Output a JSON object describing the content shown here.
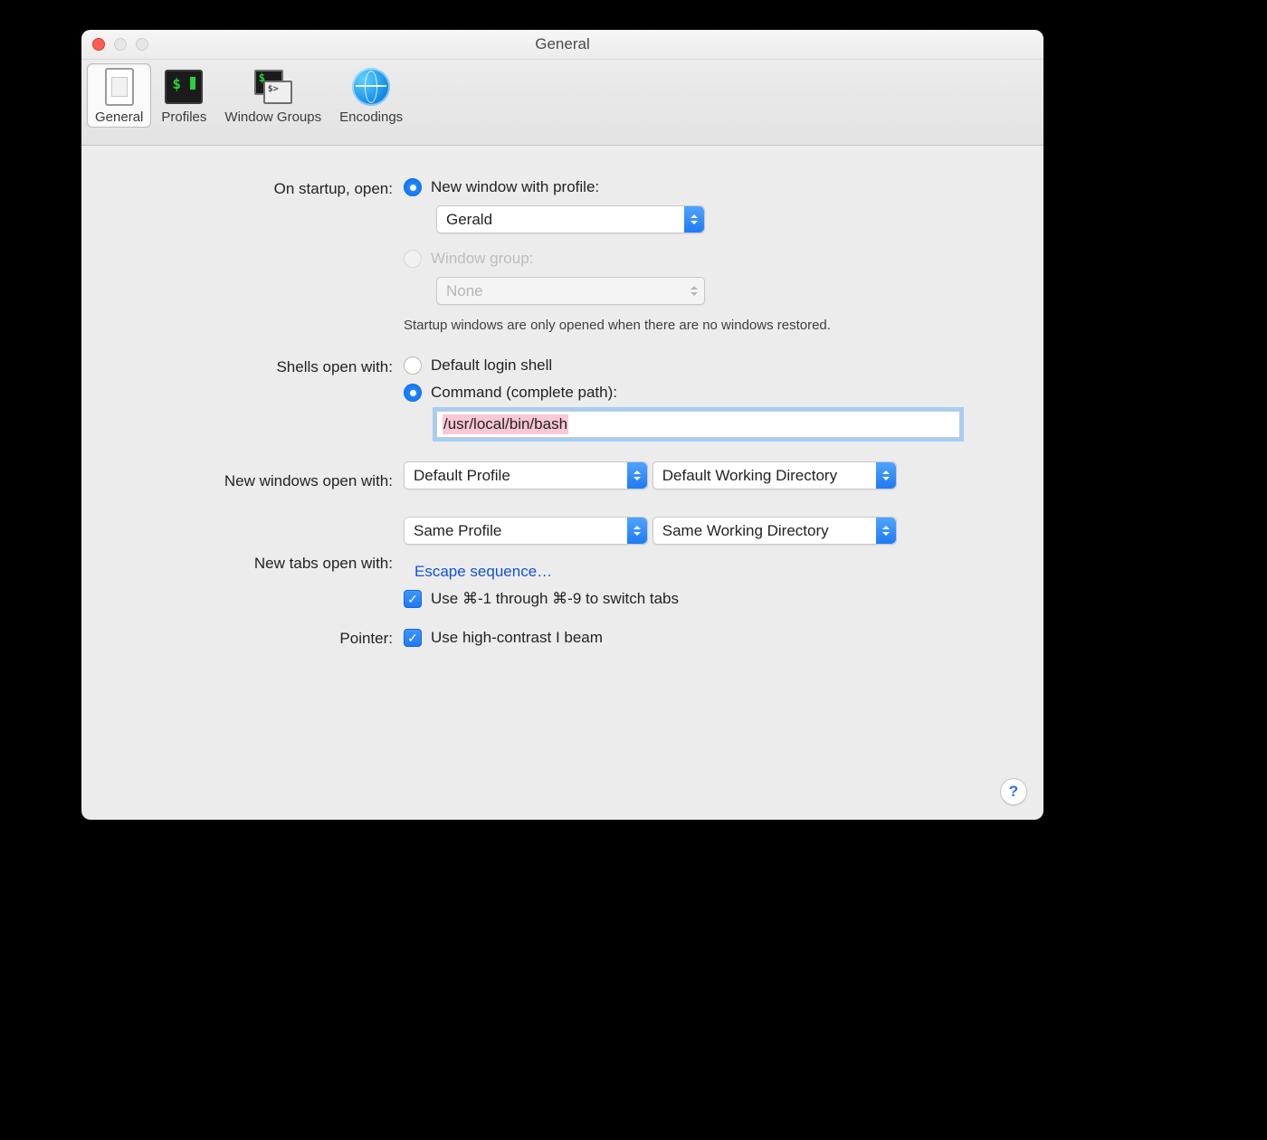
{
  "window": {
    "title": "General"
  },
  "toolbar": {
    "items": [
      {
        "label": "General"
      },
      {
        "label": "Profiles"
      },
      {
        "label": "Window Groups"
      },
      {
        "label": "Encodings"
      }
    ]
  },
  "startup": {
    "label": "On startup, open:",
    "new_window_label": "New window with profile:",
    "profile_value": "Gerald",
    "window_group_label": "Window group:",
    "window_group_value": "None",
    "note": "Startup windows are only opened when there are no windows restored."
  },
  "shells": {
    "label": "Shells open with:",
    "default_label": "Default login shell",
    "command_label": "Command (complete path):",
    "command_value": "/usr/local/bin/bash"
  },
  "new_windows": {
    "label": "New windows open with:",
    "profile": "Default Profile",
    "dir": "Default Working Directory"
  },
  "new_tabs": {
    "label": "New tabs open with:",
    "profile": "Same Profile",
    "dir": "Same Working Directory",
    "escape_link": "Escape sequence…",
    "cmd_switch_label": "Use ⌘-1 through ⌘-9 to switch tabs"
  },
  "pointer": {
    "label": "Pointer:",
    "ibeam_label": "Use high-contrast I beam"
  },
  "help": {
    "glyph": "?"
  }
}
